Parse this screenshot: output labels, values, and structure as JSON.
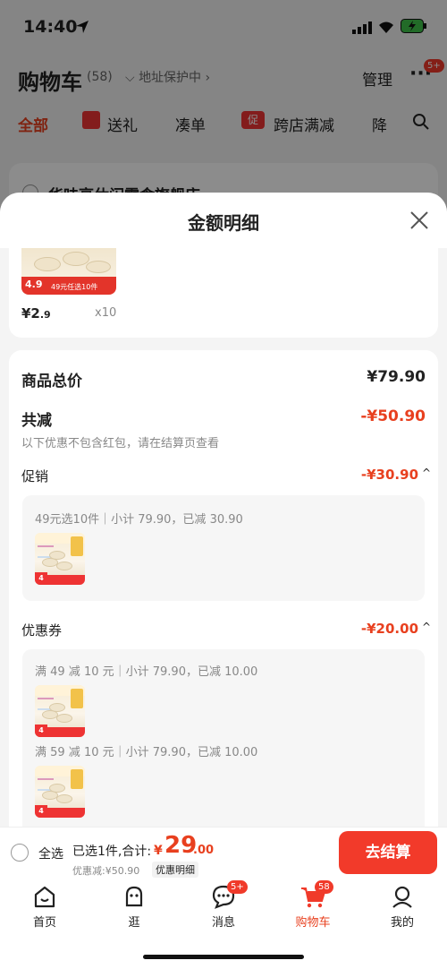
{
  "status_bar": {
    "time": "14:40"
  },
  "background": {
    "title": "购物车",
    "count": "(58)",
    "address": "地址保护中",
    "manage": "管理",
    "more_badge": "5+",
    "tabs": [
      {
        "label": "全部"
      },
      {
        "label": "送礼"
      },
      {
        "label": "凑单"
      },
      {
        "label": "跨店满减"
      },
      {
        "label": "降"
      }
    ],
    "store_partial": "华味亨休闲零食旗舰店"
  },
  "sheet": {
    "title": "金额明细",
    "product": {
      "price_int": "¥2",
      "price_dec": ".9",
      "qty": "x10",
      "tag_price": "4.9",
      "tag_promo": "49元任选10件"
    },
    "total_label": "商品总价",
    "total_value": "¥79.90",
    "discount_label": "共减",
    "discount_value": "-¥50.90",
    "discount_note": "以下优惠不包含红包，请在结算页查看",
    "promo": {
      "label": "促销",
      "value": "-¥30.90",
      "items": [
        {
          "desc": "49元选10件｜小计 79.90，已减 30.90"
        }
      ]
    },
    "coupon": {
      "label": "优惠券",
      "value": "-¥20.00",
      "items": [
        {
          "desc": "满 49 减 10 元｜小计 79.90，已减 10.00"
        },
        {
          "desc": "满 59 减 10 元｜小计 79.90，已减 10.00"
        }
      ]
    }
  },
  "checkout": {
    "select_all": "全选",
    "selected_text": "已选1件,合计:",
    "currency": "¥",
    "amount_int": "29",
    "amount_dec": ".00",
    "saved": "优惠减:¥50.90",
    "detail_link": "优惠明细",
    "button": "去结算"
  },
  "tabbar": {
    "items": [
      {
        "label": "首页",
        "icon": "home-icon"
      },
      {
        "label": "逛",
        "icon": "browse-icon"
      },
      {
        "label": "消息",
        "icon": "message-icon",
        "badge": "5+"
      },
      {
        "label": "购物车",
        "icon": "cart-icon",
        "badge": "58"
      },
      {
        "label": "我的",
        "icon": "profile-icon"
      }
    ]
  },
  "colors": {
    "accent": "#e8401f",
    "checkout_button": "#f23a2a"
  }
}
